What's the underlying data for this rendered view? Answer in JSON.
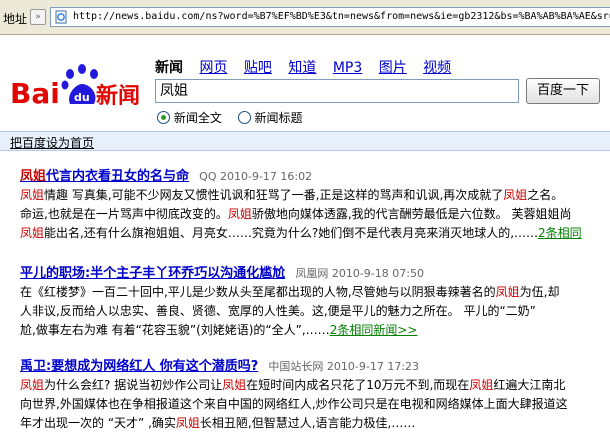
{
  "browser": {
    "address_label": "地址",
    "url": "http://news.baidu.com/ns?word=%B7%EF%BD%E3&tn=news&from=news&ie=gb2312&bs=%BA%AB%BA%AE&sr="
  },
  "header": {
    "logo_text": "Bai",
    "logo_paw_text": "du",
    "logo_news": "新闻",
    "nav": [
      {
        "label": "新闻",
        "active": true
      },
      {
        "label": "网页"
      },
      {
        "label": "贴吧"
      },
      {
        "label": "知道"
      },
      {
        "label": "MP3"
      },
      {
        "label": "图片"
      },
      {
        "label": "视频"
      }
    ],
    "search_value": "凤姐",
    "search_button": "百度一下",
    "radio_fulltext": "新闻全文",
    "radio_title": "新闻标题",
    "set_homepage": "把百度设为首页"
  },
  "results": [
    {
      "title_kw": "凤姐",
      "title_rest": "代言内衣看丑女的名与命",
      "source": "QQ 2010-9-17 16:02",
      "line1_kw": "凤姐",
      "line1": "情趣  写真集,可能不少网友又惯性讥讽和狂骂了一番,正是这样的骂声和讥讽,再次成就了",
      "line1_kw2": "凤姐",
      "line1_tail": "之名。",
      "line2_a": "命运,也就是在一片骂声中彻底改变的。",
      "line2_kw": "凤姐",
      "line2_b": "骄傲地向媒体透露,我的代言酬劳最低是六位数。  芙蓉姐姐尚",
      "line3_kw": "凤姐",
      "line3": "能出名,还有什么旗袍姐姐、月亮女……究竟为什么?她们倒不是代表月亮来消灭地球人的,……",
      "more": "2条相同"
    },
    {
      "title": "平儿的职场:半个主子丰丫环乔巧以沟通化尴尬",
      "source": "凤凰网  2010-9-18 07:50",
      "line1_a": "在《红楼梦》一百二十回中,平儿是少数从头至尾都出现的人物,尽管她与以阴狠毒辣著名的",
      "line1_kw": "凤姐",
      "line1_b": "为伍,却",
      "line2": "人非议,反而给人以忠实、善良、贤德、宽厚的人性美。这,便是平儿的魅力之所在。  平儿的“二奶”",
      "line3": "尬,做事左右为难  有着“花容玉貌”(刘姥姥语)的“全人”,……",
      "more": "2条相同新闻>>"
    },
    {
      "title": "禹卫:要想成为网络红人  你有这个潜质吗?",
      "source": "中国站长网  2010-9-17 17:23",
      "line1_kw": "凤姐",
      "line1_a": "为什么会红? 据说当初炒作公司让",
      "line1_kw2": "凤姐",
      "line1_b": "在短时间内成名只花了10万元不到,而现在",
      "line1_kw3": "凤姐",
      "line1_c": "红遍大江南北",
      "line2": "向世界,外国媒体也在争相报道这个来自中国的网络红人,炒作公司只是在电视和网络媒体上面大肆报道这",
      "line3_a": "年才出现一次的 “天才”  ,确实",
      "line3_kw": "凤姐",
      "line3_b": "长相丑陋,但智慧过人,语言能力极佳,……"
    }
  ],
  "colors": {
    "logo_red": "#e10601",
    "logo_blue": "#2319dc",
    "link_blue": "#0000cc",
    "keyword_red": "#cc0000",
    "more_green": "#008000"
  }
}
